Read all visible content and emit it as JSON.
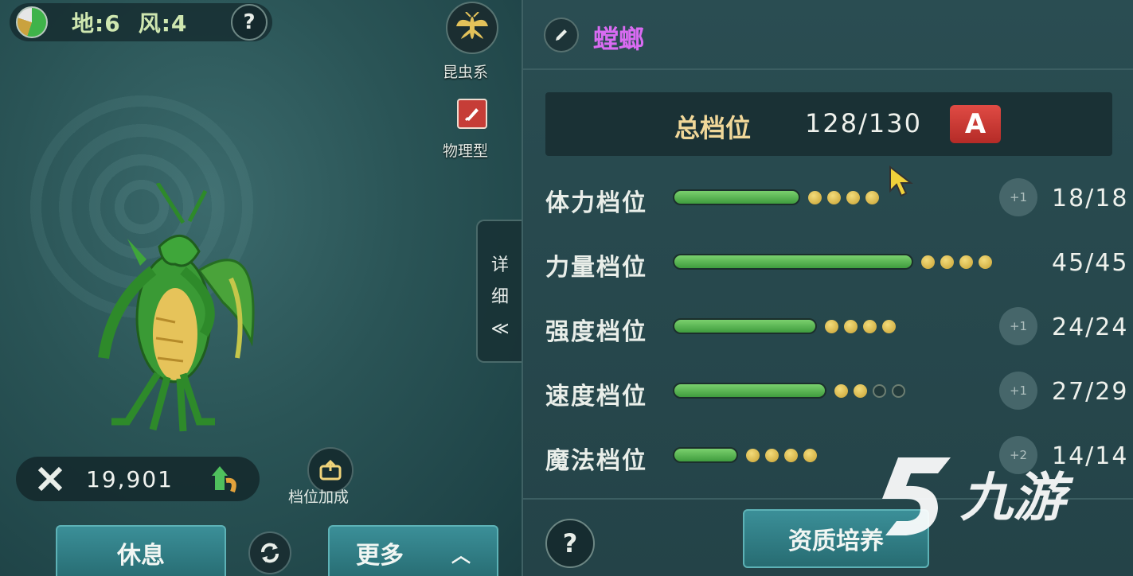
{
  "left": {
    "element_earth": "地:6",
    "element_wind": "风:4",
    "help": "?",
    "type_label": "昆虫系",
    "attack_label": "物理型",
    "detail_tab": [
      "详",
      "细",
      "≪"
    ],
    "power": "19,901",
    "bonus_label": "档位加成",
    "rest_button": "休息",
    "more_button": "更多"
  },
  "right": {
    "pet_name": "螳螂",
    "total_label": "总档位",
    "total_value": "128/130",
    "grade": "A",
    "stats": [
      {
        "label": "体力档位",
        "value": "18/18",
        "bar": 0.53,
        "dots_on": 4,
        "dots_total": 4,
        "plus": "+1"
      },
      {
        "label": "力量档位",
        "value": "45/45",
        "bar": 1.0,
        "dots_on": 4,
        "dots_total": 4,
        "plus": ""
      },
      {
        "label": "强度档位",
        "value": "24/24",
        "bar": 0.6,
        "dots_on": 4,
        "dots_total": 4,
        "plus": "+1"
      },
      {
        "label": "速度档位",
        "value": "27/29",
        "bar": 0.64,
        "dots_on": 2,
        "dots_total": 4,
        "plus": "+1"
      },
      {
        "label": "魔法档位",
        "value": "14/14",
        "bar": 0.27,
        "dots_on": 4,
        "dots_total": 4,
        "plus": "+2"
      }
    ],
    "help": "?",
    "train_button": "资质培养"
  },
  "watermark": "九游",
  "colors": {
    "name": "#d96bf2",
    "grade": "#d63b35",
    "bar": "#5cb855",
    "dot": "#e0bf55"
  }
}
